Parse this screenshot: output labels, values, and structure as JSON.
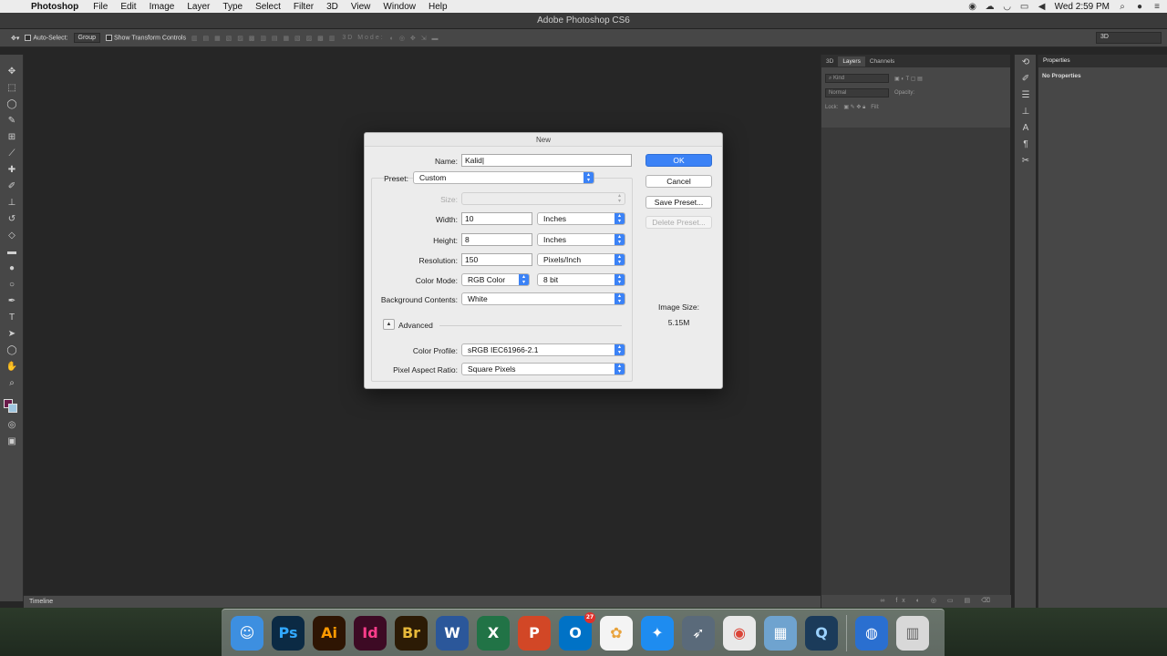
{
  "menubar": {
    "app_name": "Photoshop",
    "items": [
      "File",
      "Edit",
      "Image",
      "Layer",
      "Type",
      "Select",
      "Filter",
      "3D",
      "View",
      "Window",
      "Help"
    ],
    "clock": "Wed 2:59 PM"
  },
  "window_title": "Adobe Photoshop CS6",
  "options_bar": {
    "auto_select": "Auto-Select:",
    "group": "Group",
    "transform": "Show Transform Controls",
    "mode_3d": "3D Mode:",
    "workspace": "3D"
  },
  "layers_panel": {
    "tabs": [
      "3D",
      "Layers",
      "Channels"
    ],
    "kind": "Kind",
    "blend": "Normal",
    "opacity_label": "Opacity:",
    "lock_label": "Lock:",
    "fill_label": "Fill:"
  },
  "properties_panel": {
    "tab": "Properties",
    "message": "No Properties"
  },
  "timeline": "Timeline",
  "dialog": {
    "title": "New",
    "name_label": "Name:",
    "name_value": "Kalid",
    "preset_label": "Preset:",
    "preset_value": "Custom",
    "size_label": "Size:",
    "width_label": "Width:",
    "width_value": "10",
    "width_unit": "Inches",
    "height_label": "Height:",
    "height_value": "8",
    "height_unit": "Inches",
    "resolution_label": "Resolution:",
    "resolution_value": "150",
    "resolution_unit": "Pixels/Inch",
    "color_mode_label": "Color Mode:",
    "color_mode_value": "RGB Color",
    "bit_depth": "8 bit",
    "background_label": "Background Contents:",
    "background_value": "White",
    "advanced_label": "Advanced",
    "color_profile_label": "Color Profile:",
    "color_profile_value": "sRGB IEC61966-2.1",
    "pixel_aspect_label": "Pixel Aspect Ratio:",
    "pixel_aspect_value": "Square Pixels",
    "ok": "OK",
    "cancel": "Cancel",
    "save_preset": "Save Preset...",
    "delete_preset": "Delete Preset...",
    "image_size_label": "Image Size:",
    "image_size_value": "5.15M"
  },
  "dock": {
    "mail_badge": "27",
    "apps": [
      {
        "name": "finder-icon",
        "glyph": "☺",
        "bg": "#3d8fe0",
        "fg": "#fff"
      },
      {
        "name": "photoshop-icon",
        "glyph": "Ps",
        "bg": "#0b2a44",
        "fg": "#31a8ff"
      },
      {
        "name": "illustrator-icon",
        "glyph": "Ai",
        "bg": "#2e1503",
        "fg": "#ff9a00"
      },
      {
        "name": "indesign-icon",
        "glyph": "Id",
        "bg": "#3d0a24",
        "fg": "#ff3d8b"
      },
      {
        "name": "bridge-icon",
        "glyph": "Br",
        "bg": "#2c1b05",
        "fg": "#e8b93a"
      },
      {
        "name": "word-icon",
        "glyph": "W",
        "bg": "#2b579a",
        "fg": "#fff"
      },
      {
        "name": "excel-icon",
        "glyph": "X",
        "bg": "#217346",
        "fg": "#fff"
      },
      {
        "name": "powerpoint-icon",
        "glyph": "P",
        "bg": "#d24726",
        "fg": "#fff"
      },
      {
        "name": "outlook-icon",
        "glyph": "O",
        "bg": "#0072c6",
        "fg": "#fff"
      },
      {
        "name": "photos-icon",
        "glyph": "✿",
        "bg": "#f4f4f4",
        "fg": "#e8a33d"
      },
      {
        "name": "safari-icon",
        "glyph": "✦",
        "bg": "#1e8cf0",
        "fg": "#fff"
      },
      {
        "name": "launchpad-icon",
        "glyph": "➶",
        "bg": "#5a6a7a",
        "fg": "#fff"
      },
      {
        "name": "chrome-icon",
        "glyph": "◉",
        "bg": "#e9e9e9",
        "fg": "#db4437"
      },
      {
        "name": "preview-icon",
        "glyph": "▦",
        "bg": "#6fa3cf",
        "fg": "#fff"
      },
      {
        "name": "quicktime-icon",
        "glyph": "Q",
        "bg": "#1b3b5a",
        "fg": "#9cd2ff"
      },
      {
        "name": "network-icon",
        "glyph": "◍",
        "bg": "#2a6fd0",
        "fg": "#fff"
      },
      {
        "name": "trash-icon",
        "glyph": "▥",
        "bg": "#d8d8d8",
        "fg": "#666"
      }
    ]
  }
}
